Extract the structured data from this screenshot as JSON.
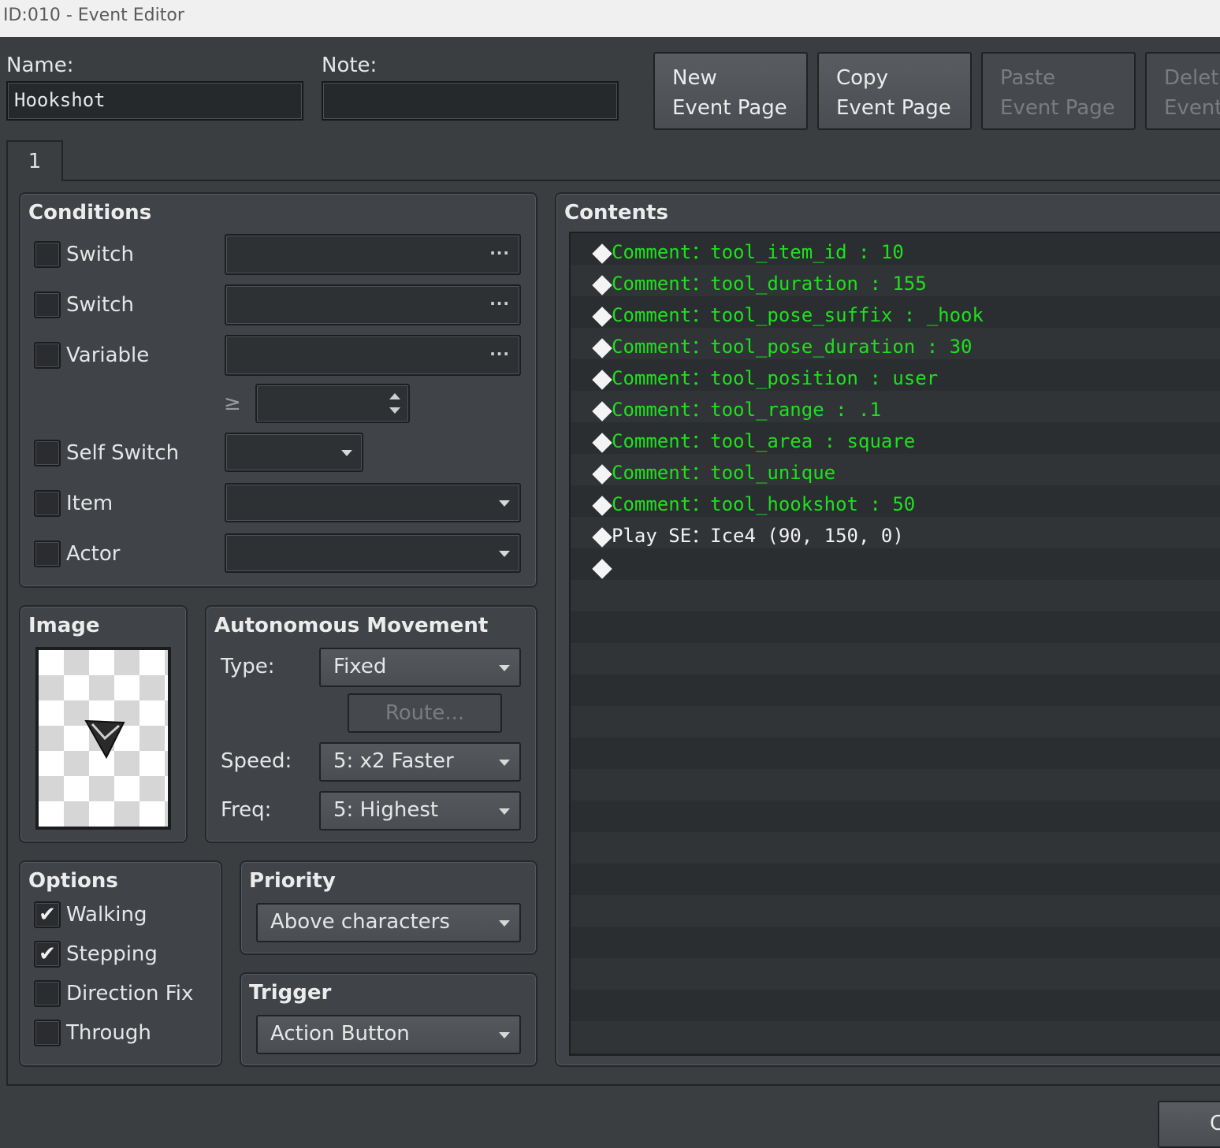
{
  "window": {
    "title": "ID:010 - Event Editor"
  },
  "header": {
    "name_label": "Name:",
    "name_value": "Hookshot",
    "note_label": "Note:",
    "note_value": "",
    "buttons": [
      {
        "line1": "New",
        "line2": "Event Page",
        "enabled": true
      },
      {
        "line1": "Copy",
        "line2": "Event Page",
        "enabled": true
      },
      {
        "line1": "Paste",
        "line2": "Event Page",
        "enabled": false
      },
      {
        "line1": "Delet",
        "line2": "Event",
        "enabled": false
      }
    ]
  },
  "tabs": [
    {
      "label": "1"
    }
  ],
  "conditions": {
    "title": "Conditions",
    "switch1_label": "Switch",
    "switch2_label": "Switch",
    "variable_label": "Variable",
    "ellipsis": "···",
    "gte_symbol": "≥",
    "self_switch_label": "Self Switch",
    "item_label": "Item",
    "actor_label": "Actor"
  },
  "image": {
    "title": "Image"
  },
  "autonomous_movement": {
    "title": "Autonomous Movement",
    "type_label": "Type:",
    "type_value": "Fixed",
    "route_button": "Route...",
    "speed_label": "Speed:",
    "speed_value": "5: x2 Faster",
    "freq_label": "Freq:",
    "freq_value": "5: Highest"
  },
  "options": {
    "title": "Options",
    "items": [
      {
        "label": "Walking",
        "checked": true
      },
      {
        "label": "Stepping",
        "checked": true
      },
      {
        "label": "Direction Fix",
        "checked": false
      },
      {
        "label": "Through",
        "checked": false
      }
    ]
  },
  "priority": {
    "title": "Priority",
    "value": "Above characters"
  },
  "trigger": {
    "title": "Trigger",
    "value": "Action Button"
  },
  "contents": {
    "title": "Contents",
    "lines": [
      {
        "cmd": "Comment",
        "sep": "：",
        "text": "tool_item_id : 10",
        "color": "#1ee01e"
      },
      {
        "cmd": "Comment",
        "sep": "：",
        "text": "tool_duration : 155",
        "color": "#1ee01e"
      },
      {
        "cmd": "Comment",
        "sep": "：",
        "text": "tool_pose_suffix : _hook",
        "color": "#1ee01e"
      },
      {
        "cmd": "Comment",
        "sep": "：",
        "text": "tool_pose_duration : 30",
        "color": "#1ee01e"
      },
      {
        "cmd": "Comment",
        "sep": "：",
        "text": "tool_position : user",
        "color": "#1ee01e"
      },
      {
        "cmd": "Comment",
        "sep": "：",
        "text": "tool_range : .1",
        "color": "#1ee01e"
      },
      {
        "cmd": "Comment",
        "sep": "：",
        "text": "tool_area : square",
        "color": "#1ee01e"
      },
      {
        "cmd": "Comment",
        "sep": "：",
        "text": "tool_unique",
        "color": "#1ee01e"
      },
      {
        "cmd": "Comment",
        "sep": "：",
        "text": "tool_hookshot : 50",
        "color": "#1ee01e"
      },
      {
        "cmd": "Play SE",
        "sep": "：",
        "text": "Ice4 (90, 150, 0)",
        "color": "#f2f2f2"
      },
      {
        "cmd": "",
        "sep": "",
        "text": "",
        "color": "#f2f2f2"
      }
    ]
  },
  "footer": {
    "ok_partial": "C"
  }
}
